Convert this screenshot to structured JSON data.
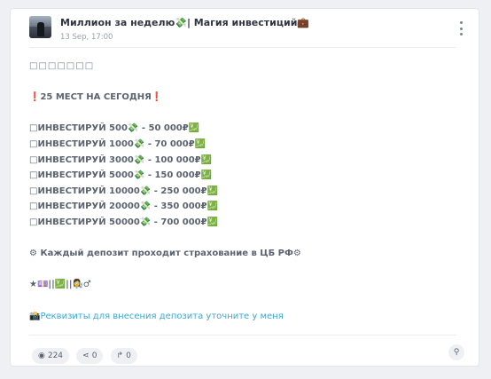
{
  "post": {
    "channel_name": "Миллион за неделю💸| Магия инвестиций💼",
    "timestamp": "13 Sep, 17:00",
    "lines": {
      "l0": "□□□□□□□",
      "l1": "❗25 МЕСТ НА СЕГОДНЯ❗",
      "l2": "□ИНВЕСТИРУЙ 500💸 - 50 000₽💹",
      "l3": "□ИНВЕСТИРУЙ 1000💸 - 70 000₽💹",
      "l4": "□ИНВЕСТИРУЙ 3000💸 - 100 000₽💹",
      "l5": "□ИНВЕСТИРУЙ 5000💸 - 150 000₽💹",
      "l6": "□ИНВЕСТИРУЙ 10000💸 - 250 000₽💹",
      "l7": "□ИНВЕСТИРУЙ 20000💸 - 350 000₽💹",
      "l8": "□ИНВЕСТИРУЙ 50000💸 - 700 000₽💹",
      "l9": "⚙ Каждый депозит проходит страхование в ЦБ РФ⚙",
      "l10": "★💷||💹||👩‍🔬♂",
      "l11": "📸Реквизиты для внесения депозита уточните у меня"
    }
  },
  "footer": {
    "views": "224",
    "shares": "0",
    "forwards": "0"
  },
  "icons": {
    "more": "kebab-icon",
    "views": "eye-icon",
    "shares": "share-icon",
    "forwards": "forward-icon",
    "link": "link-icon"
  },
  "colors": {
    "link": "#3aa8d4",
    "text": "#5b6370",
    "title": "#2f3540"
  }
}
